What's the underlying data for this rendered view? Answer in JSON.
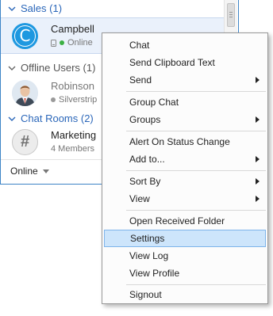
{
  "groups": {
    "sales": {
      "label": "Sales (1)"
    },
    "offline": {
      "label": "Offline Users (1)"
    },
    "chat_rooms": {
      "label": "Chat Rooms (2)"
    }
  },
  "contacts": {
    "campbell": {
      "initial": "C",
      "name": "Campbell",
      "status": "Online"
    },
    "robinson": {
      "name": "Robinson",
      "status": "Silverstrip"
    },
    "marketing": {
      "avatar_glyph": "#",
      "name": "Marketing",
      "members": "4 Members"
    }
  },
  "status_bar": {
    "status": "Online"
  },
  "context_menu": {
    "items": [
      {
        "label": "Chat",
        "submenu": false
      },
      {
        "label": "Send Clipboard Text",
        "submenu": false
      },
      {
        "label": "Send",
        "submenu": true
      },
      {
        "label": "Group Chat",
        "submenu": false
      },
      {
        "label": "Groups",
        "submenu": true
      },
      {
        "label": "Alert On Status Change",
        "submenu": false
      },
      {
        "label": "Add to...",
        "submenu": true
      },
      {
        "label": "Sort By",
        "submenu": true
      },
      {
        "label": "View",
        "submenu": true
      },
      {
        "label": "Open Received Folder",
        "submenu": false
      },
      {
        "label": "Settings",
        "submenu": false,
        "highlighted": true
      },
      {
        "label": "View Log",
        "submenu": false
      },
      {
        "label": "View Profile",
        "submenu": false
      },
      {
        "label": "Signout",
        "submenu": false
      }
    ]
  },
  "colors": {
    "accent_blue": "#2a66b9",
    "avatar_blue": "#1e98e0",
    "online_green": "#3cb043",
    "offline_gray": "#9a9a9a",
    "menu_highlight": "#cde5fb"
  }
}
